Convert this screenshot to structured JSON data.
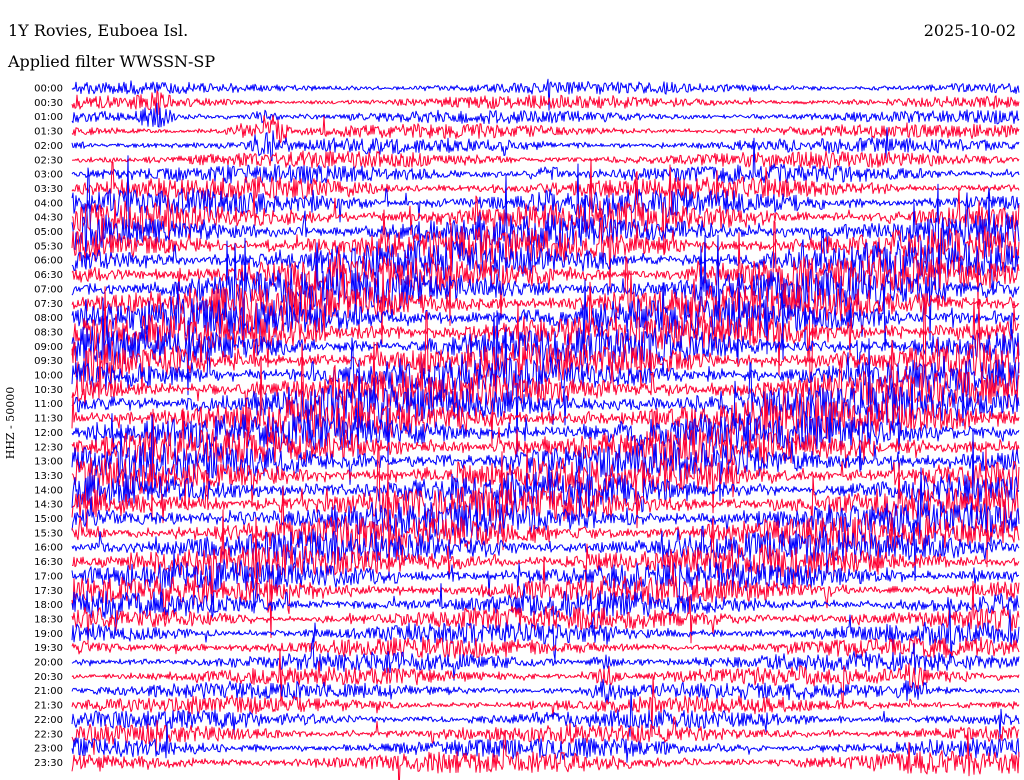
{
  "header": {
    "station": "1Y Rovies, Euboea Isl.",
    "date": "2025-10-02",
    "filter": "Applied filter WWSSN-SP"
  },
  "chart_data": {
    "type": "line",
    "title": "1Y Rovies, Euboea Isl.",
    "subtitle": "Applied filter WWSSN-SP",
    "date": "2025-10-02",
    "ylabel": "HHZ - 50000",
    "xlabel": "",
    "grid": false,
    "legend": "none",
    "series_colors": [
      "#0000ff",
      "#ff0033"
    ],
    "rows": [
      {
        "time": "00:00",
        "level": 0.04,
        "events": [
          [
            44,
            0.1
          ]
        ]
      },
      {
        "time": "00:30",
        "level": 0.05,
        "events": [
          [
            44,
            0.1
          ],
          [
            155,
            0.07
          ]
        ]
      },
      {
        "time": "01:00",
        "level": 0.06,
        "events": [
          [
            44,
            0.08
          ],
          [
            155,
            0.09
          ],
          [
            265,
            0.05
          ]
        ]
      },
      {
        "time": "01:30",
        "level": 0.08,
        "events": [
          [
            242,
            0.05
          ],
          [
            270,
            0.15
          ]
        ]
      },
      {
        "time": "02:00",
        "level": 0.1,
        "events": [
          [
            270,
            0.1
          ]
        ]
      },
      {
        "time": "02:30",
        "level": 0.14,
        "events": []
      },
      {
        "time": "03:00",
        "level": 0.2,
        "events": [
          [
            545,
            0.06
          ]
        ]
      },
      {
        "time": "03:30",
        "level": 0.3,
        "events": []
      },
      {
        "time": "04:00",
        "level": 0.4,
        "events": [
          [
            545,
            0.05
          ]
        ]
      },
      {
        "time": "04:30",
        "level": 0.5,
        "events": []
      },
      {
        "time": "05:00",
        "level": 0.55,
        "events": []
      },
      {
        "time": "05:30",
        "level": 0.6,
        "events": []
      },
      {
        "time": "06:00",
        "level": 0.65,
        "events": []
      },
      {
        "time": "06:30",
        "level": 0.68,
        "events": []
      },
      {
        "time": "07:00",
        "level": 0.7,
        "events": []
      },
      {
        "time": "07:30",
        "level": 0.7,
        "events": []
      },
      {
        "time": "08:00",
        "level": 0.68,
        "events": []
      },
      {
        "time": "08:30",
        "level": 0.66,
        "events": []
      },
      {
        "time": "09:00",
        "level": 0.65,
        "events": []
      },
      {
        "time": "09:30",
        "level": 0.64,
        "events": []
      },
      {
        "time": "10:00",
        "level": 0.64,
        "events": []
      },
      {
        "time": "10:30",
        "level": 0.66,
        "events": []
      },
      {
        "time": "11:00",
        "level": 0.68,
        "events": []
      },
      {
        "time": "11:30",
        "level": 0.68,
        "events": []
      },
      {
        "time": "12:00",
        "level": 0.66,
        "events": []
      },
      {
        "time": "12:30",
        "level": 0.64,
        "events": []
      },
      {
        "time": "13:00",
        "level": 0.64,
        "events": []
      },
      {
        "time": "13:30",
        "level": 0.62,
        "events": []
      },
      {
        "time": "14:00",
        "level": 0.6,
        "events": []
      },
      {
        "time": "14:30",
        "level": 0.6,
        "events": []
      },
      {
        "time": "15:00",
        "level": 0.58,
        "events": []
      },
      {
        "time": "15:30",
        "level": 0.58,
        "events": []
      },
      {
        "time": "16:00",
        "level": 0.56,
        "events": []
      },
      {
        "time": "16:30",
        "level": 0.52,
        "events": []
      },
      {
        "time": "17:00",
        "level": 0.48,
        "events": []
      },
      {
        "time": "17:30",
        "level": 0.42,
        "events": []
      },
      {
        "time": "18:00",
        "level": 0.36,
        "events": []
      },
      {
        "time": "18:30",
        "level": 0.3,
        "events": []
      },
      {
        "time": "19:00",
        "level": 0.26,
        "events": []
      },
      {
        "time": "19:30",
        "level": 0.22,
        "events": []
      },
      {
        "time": "20:00",
        "level": 0.2,
        "events": [
          [
            605,
            0.06
          ]
        ]
      },
      {
        "time": "20:30",
        "level": 0.18,
        "events": [
          [
            605,
            0.07
          ],
          [
            915,
            0.08
          ]
        ]
      },
      {
        "time": "21:00",
        "level": 0.16,
        "events": [
          [
            605,
            0.08
          ],
          [
            915,
            0.08
          ]
        ]
      },
      {
        "time": "21:30",
        "level": 0.16,
        "events": []
      },
      {
        "time": "22:00",
        "level": 0.18,
        "events": []
      },
      {
        "time": "22:30",
        "level": 0.2,
        "events": []
      },
      {
        "time": "23:00",
        "level": 0.22,
        "events": []
      },
      {
        "time": "23:30",
        "level": 0.26,
        "events": []
      }
    ]
  }
}
